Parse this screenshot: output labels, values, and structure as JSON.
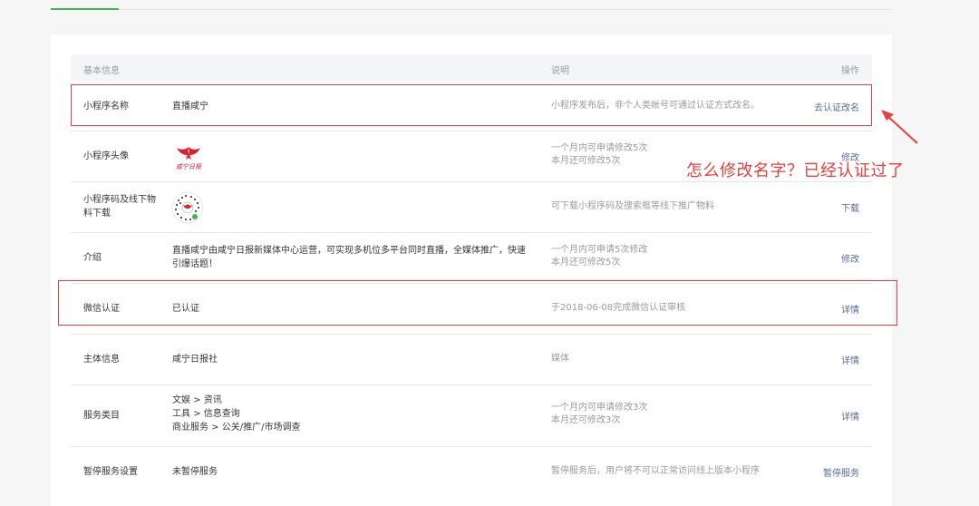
{
  "header": {
    "basic_info": "基本信息",
    "description": "说明",
    "operation": "操作"
  },
  "rows": [
    {
      "label": "小程序名称",
      "value": "直播咸宁",
      "desc_lines": [
        "小程序发布后，非个人类帐号可通过认证方式改名。"
      ],
      "action": "去认证改名"
    },
    {
      "label": "小程序头像",
      "value": "",
      "logo_text": "咸宁日报",
      "desc_lines": [
        "一个月内可申请修改5次",
        "本月还可修改5次"
      ],
      "action": "修改"
    },
    {
      "label_lines": [
        "小程序码及线下物",
        "料下载"
      ],
      "value": "",
      "desc_lines": [
        "可下载小程序码及搜索框等线下推广物料"
      ],
      "action": "下载"
    },
    {
      "label": "介绍",
      "value_lines": [
        "直播咸宁由咸宁日报新媒体中心运营，可实现多机位多平台同时直播，全媒体推广，快速",
        "引爆话题！"
      ],
      "desc_lines": [
        "一个月内可申请5次修改",
        "本月还可修改5次"
      ],
      "action": "修改"
    },
    {
      "label": "微信认证",
      "value": "已认证",
      "desc_lines": [
        "于2018-06-08完成微信认证审核"
      ],
      "action": "详情"
    },
    {
      "label": "主体信息",
      "value": "咸宁日报社",
      "desc_lines": [
        "媒体"
      ],
      "action": "详情"
    },
    {
      "label": "服务类目",
      "value_lines": [
        "文娱 > 资讯",
        "工具 > 信息查询",
        "商业服务 > 公关/推广/市场调查"
      ],
      "desc_lines": [
        "一个月内可申请修改3次",
        "本月还可修改3次"
      ],
      "action": "详情"
    },
    {
      "label": "暂停服务设置",
      "value": "未暂停服务",
      "desc_lines": [
        "暂停服务后，用户将不可以正常访问线上版本小程序"
      ],
      "action": "暂停服务"
    }
  ],
  "annotation": {
    "text": "怎么修改名字？已经认证过了",
    "color": "#e8403c"
  },
  "colors": {
    "link": "#576b95",
    "accent": "#44b549",
    "muted": "#9a9a9a"
  }
}
